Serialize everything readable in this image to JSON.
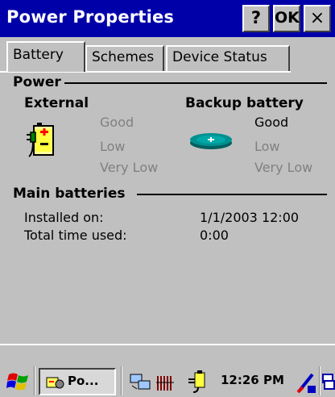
{
  "window": {
    "title": "Power Properties",
    "help_label": "?",
    "ok_label": "OK",
    "close_label": "×"
  },
  "tabs": [
    {
      "label": "Battery",
      "active": true
    },
    {
      "label": "Schemes",
      "active": false
    },
    {
      "label": "Device Status",
      "active": false
    }
  ],
  "power": {
    "heading": "Power",
    "external": {
      "label": "External",
      "statuses": [
        "Good",
        "Low",
        "Very Low"
      ],
      "active_index": -1
    },
    "backup": {
      "label": "Backup battery",
      "statuses": [
        "Good",
        "Low",
        "Very Low"
      ],
      "active_index": 0
    }
  },
  "main_batteries": {
    "heading": "Main batteries",
    "installed_label": "Installed on:",
    "installed_value": "1/1/2003 12:00",
    "time_used_label": "Total time used:",
    "time_used_value": "0:00"
  },
  "taskbar": {
    "task_label": "Po...",
    "clock": "12:26 PM"
  },
  "icons": {
    "start": "windows-flag-icon",
    "task": "power-properties-icon",
    "network": "network-connection-icon",
    "signal": "signal-bars-icon",
    "power": "ac-power-icon",
    "input": "input-panel-icon",
    "desktop": "show-desktop-icon"
  }
}
